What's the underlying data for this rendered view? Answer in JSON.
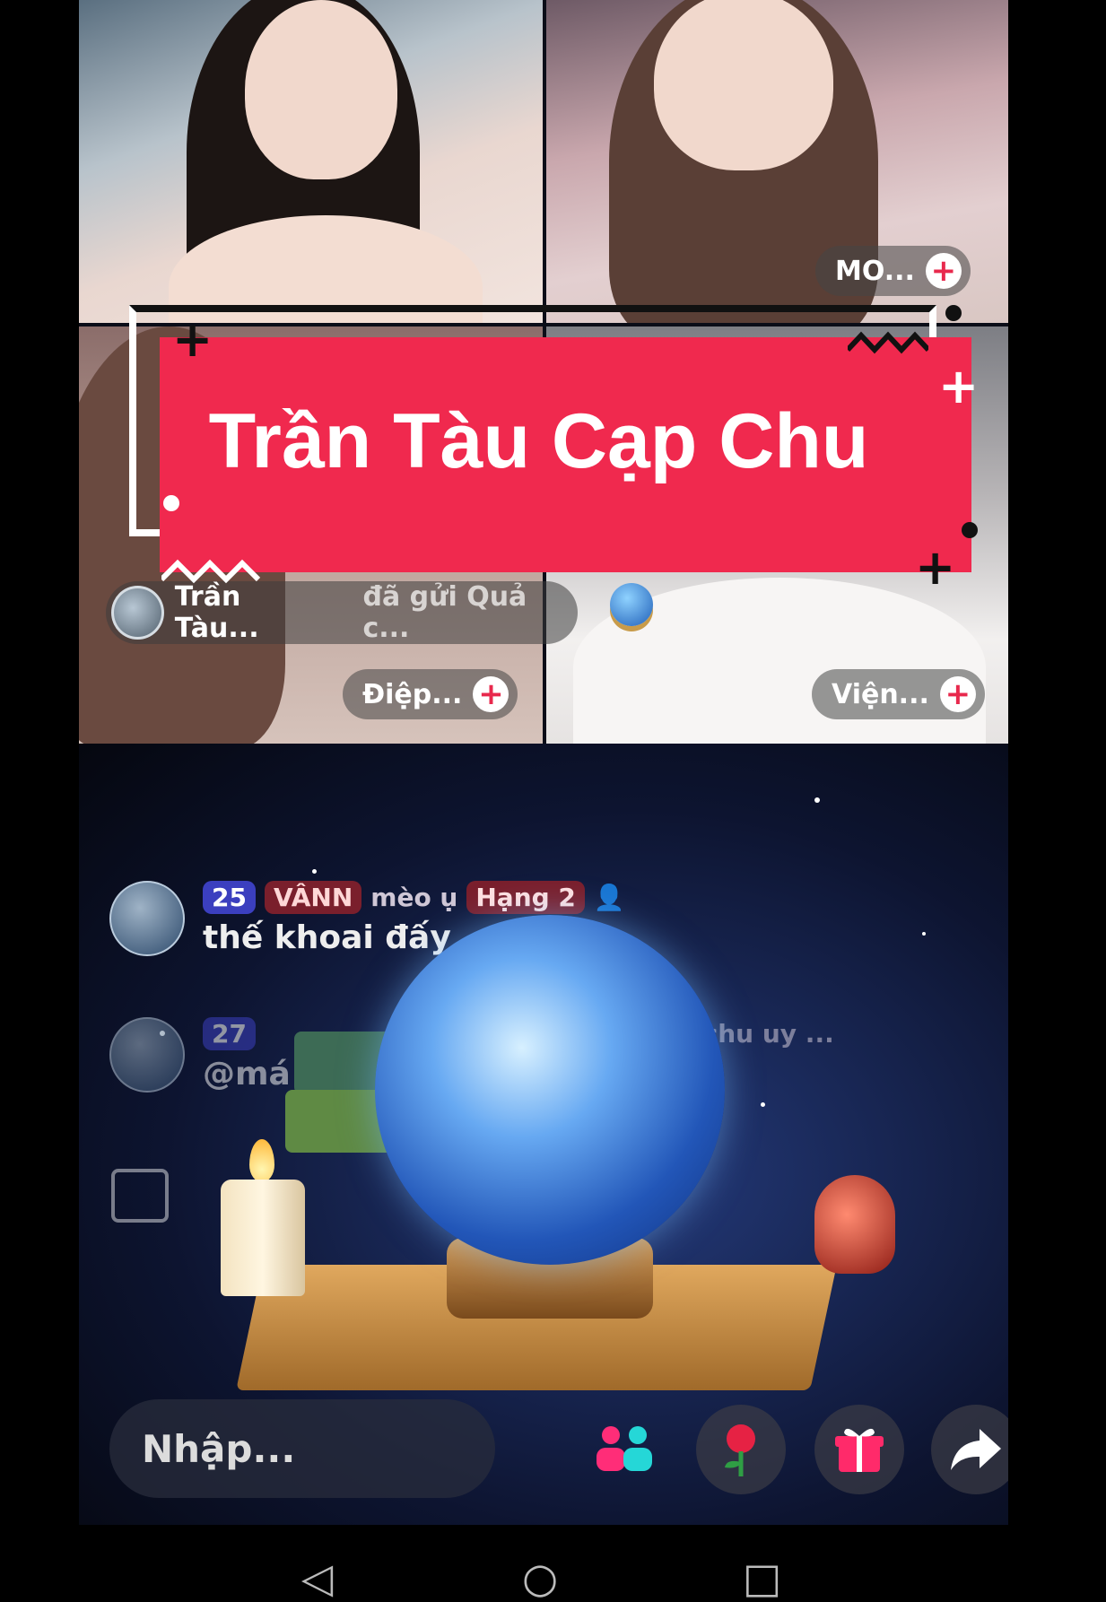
{
  "tiles": [
    {
      "name": "",
      "action": ""
    },
    {
      "name": "MO...",
      "action": "+"
    },
    {
      "name": "Điệp...",
      "action": "+"
    },
    {
      "name": "Viện...",
      "action": "+"
    }
  ],
  "gift_banner": {
    "user": "Trần Tàu...",
    "text": "đã gửi Quả c..."
  },
  "title_overlay": {
    "text": "Trần Tàu Cạp Chu",
    "accent": "#f0294e"
  },
  "chat": {
    "messages": [
      {
        "level": "25",
        "fan_badge": "VÂNN",
        "username": "mèo ụ",
        "rank": "Hạng 2",
        "text": "thế khoai đấy"
      },
      {
        "level": "27",
        "fan_badge": "",
        "username": "ạp chu uy ...",
        "rank": "",
        "text": "@má"
      }
    ]
  },
  "bottom_bar": {
    "input_placeholder": "Nhập...",
    "icons": [
      "people-icon",
      "rose-icon",
      "gift-icon",
      "share-icon"
    ]
  },
  "nav": {
    "back": "◁",
    "home": "○",
    "recent": "□"
  }
}
